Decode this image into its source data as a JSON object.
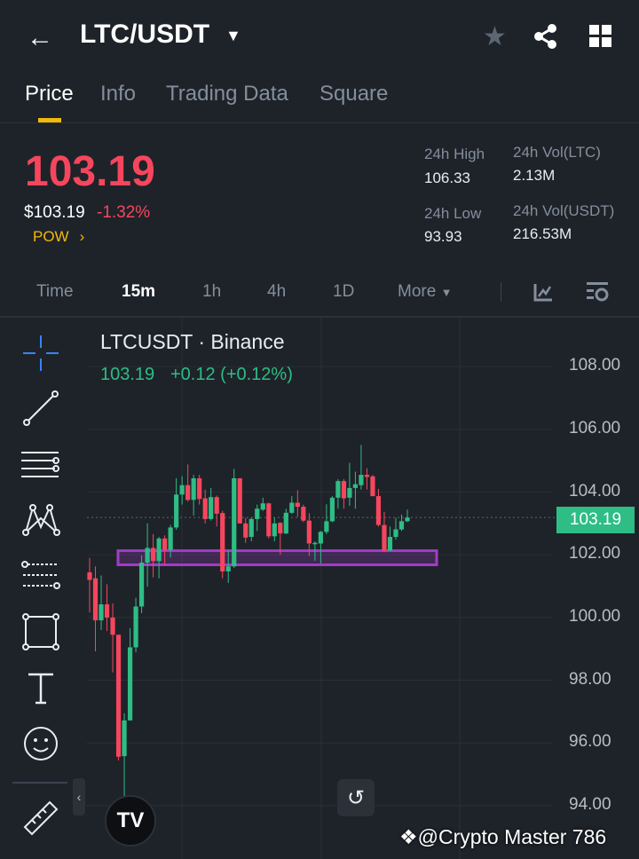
{
  "header": {
    "title": "LTC/USDT"
  },
  "tabs": [
    "Price",
    "Info",
    "Trading Data",
    "Square"
  ],
  "price": {
    "last": "103.19",
    "usd": "$103.19",
    "change": "-1.32%",
    "tag": "POW"
  },
  "stats": {
    "high_label": "24h High",
    "high": "106.33",
    "low_label": "24h Low",
    "low": "93.93",
    "vol_ltc_label": "24h Vol(LTC)",
    "vol_ltc": "2.13M",
    "vol_usdt_label": "24h Vol(USDT)",
    "vol_usdt": "216.53M"
  },
  "timeframes": [
    "Time",
    "15m",
    "1h",
    "4h",
    "1D",
    "More"
  ],
  "chart": {
    "symbol": "LTCUSDT · Binance",
    "last": "103.19",
    "change": "+0.12 (+0.12%)",
    "price_tag": "103.19"
  },
  "watermark": "@Crypto Master 786",
  "colors": {
    "up": "#2ebd85",
    "down": "#f6465d",
    "accent": "#f0b90b",
    "zone": "#a03cc8"
  },
  "chart_data": {
    "type": "candlestick",
    "ylim": [
      92.3,
      109.56
    ],
    "yticks": [
      "108.00",
      "106.00",
      "104.00",
      "102.00",
      "100.00",
      "98.00",
      "96.00",
      "94.00"
    ],
    "last_price": 103.19,
    "zone": {
      "from": 101.68,
      "to": 102.13
    },
    "ohlc": [
      [
        101.44,
        101.9,
        100.16,
        101.2
      ],
      [
        101.25,
        101.63,
        98.92,
        99.91
      ],
      [
        99.91,
        101.34,
        99.6,
        100.42
      ],
      [
        100.42,
        101.06,
        99.57,
        100.0
      ],
      [
        100.0,
        100.45,
        98.25,
        99.45
      ],
      [
        99.45,
        99.45,
        95.44,
        95.56
      ],
      [
        95.58,
        96.95,
        94.2,
        96.72
      ],
      [
        96.72,
        99.66,
        96.72,
        99.05
      ],
      [
        99.05,
        100.63,
        98.89,
        100.35
      ],
      [
        100.35,
        101.98,
        100.14,
        101.75
      ],
      [
        101.75,
        103.0,
        100.98,
        102.22
      ],
      [
        102.22,
        102.66,
        101.28,
        101.8
      ],
      [
        101.8,
        102.57,
        101.25,
        102.52
      ],
      [
        102.52,
        102.62,
        101.67,
        102.15
      ],
      [
        102.15,
        102.95,
        101.91,
        102.87
      ],
      [
        102.87,
        104.44,
        102.8,
        103.92
      ],
      [
        103.92,
        104.51,
        103.6,
        104.22
      ],
      [
        104.22,
        104.88,
        103.7,
        103.75
      ],
      [
        103.75,
        104.55,
        103.25,
        104.44
      ],
      [
        104.44,
        104.55,
        103.6,
        103.78
      ],
      [
        103.8,
        104.08,
        103.0,
        103.14
      ],
      [
        103.14,
        104.13,
        103.09,
        103.84
      ],
      [
        103.84,
        103.89,
        102.9,
        103.31
      ],
      [
        103.33,
        103.4,
        101.25,
        101.47
      ],
      [
        101.47,
        102.14,
        101.1,
        101.63
      ],
      [
        101.63,
        104.74,
        101.58,
        104.44
      ],
      [
        104.44,
        104.44,
        103.0,
        103.0
      ],
      [
        103.0,
        103.18,
        102.38,
        102.55
      ],
      [
        102.57,
        103.18,
        102.43,
        103.14
      ],
      [
        103.14,
        103.6,
        102.76,
        103.47
      ],
      [
        103.44,
        103.82,
        103.4,
        103.64
      ],
      [
        103.64,
        103.66,
        102.52,
        102.59
      ],
      [
        102.59,
        103.18,
        102.43,
        103.0
      ],
      [
        103.02,
        103.04,
        102.0,
        102.68
      ],
      [
        102.68,
        103.47,
        102.66,
        103.34
      ],
      [
        103.34,
        103.87,
        103.31,
        103.66
      ],
      [
        103.66,
        104.06,
        103.21,
        103.53
      ],
      [
        103.53,
        103.6,
        103.04,
        103.09
      ],
      [
        103.09,
        103.33,
        101.96,
        102.36
      ],
      [
        102.36,
        102.43,
        101.81,
        102.38
      ],
      [
        102.36,
        102.76,
        101.72,
        102.73
      ],
      [
        102.73,
        103.61,
        102.66,
        103.07
      ],
      [
        103.07,
        103.87,
        103.04,
        103.82
      ],
      [
        103.82,
        104.41,
        103.47,
        104.35
      ],
      [
        104.35,
        104.41,
        103.47,
        103.8
      ],
      [
        103.82,
        104.93,
        103.56,
        104.13
      ],
      [
        104.13,
        104.65,
        103.47,
        104.25
      ],
      [
        104.22,
        105.5,
        104.08,
        104.55
      ],
      [
        104.55,
        104.76,
        104.08,
        104.48
      ],
      [
        104.5,
        104.55,
        103.87,
        103.87
      ],
      [
        103.87,
        104.1,
        102.9,
        102.95
      ],
      [
        102.95,
        103.37,
        102.08,
        102.13
      ],
      [
        102.13,
        102.9,
        102.13,
        102.57
      ],
      [
        102.57,
        103.18,
        102.48,
        102.81
      ],
      [
        102.81,
        103.28,
        102.76,
        103.07
      ],
      [
        103.07,
        103.44,
        103.04,
        103.19
      ]
    ]
  }
}
